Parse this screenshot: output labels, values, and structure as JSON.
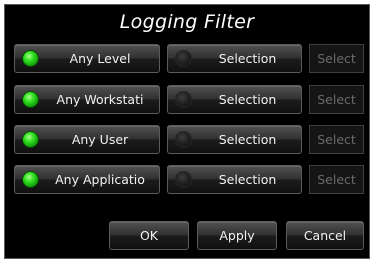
{
  "dialog": {
    "title": "Logging Filter",
    "rows": [
      {
        "filter_label": "Any Level",
        "filter_on": true,
        "selection_label": "Selection",
        "select_label": "Select"
      },
      {
        "filter_label": "Any Workstati",
        "filter_on": true,
        "selection_label": "Selection",
        "select_label": "Select"
      },
      {
        "filter_label": "Any User",
        "filter_on": true,
        "selection_label": "Selection",
        "select_label": "Select"
      },
      {
        "filter_label": "Any Applicatio",
        "filter_on": true,
        "selection_label": "Selection",
        "select_label": "Select"
      }
    ],
    "buttons": {
      "ok": "OK",
      "apply": "Apply",
      "cancel": "Cancel"
    }
  },
  "colors": {
    "led_on": "#2ecc1a",
    "led_off": "#1e1e1e",
    "background": "#000000",
    "disabled_text": "#6a6a6a"
  }
}
